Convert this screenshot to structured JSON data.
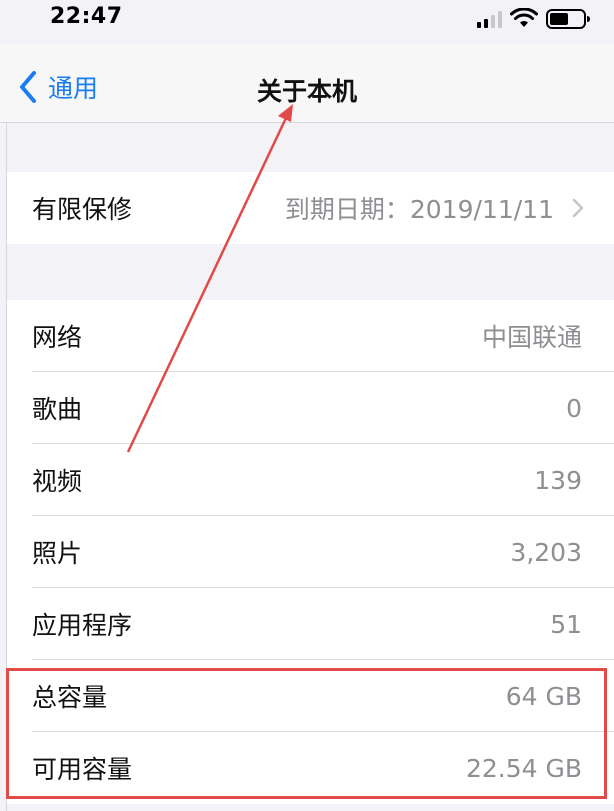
{
  "status_bar": {
    "time": "22:47"
  },
  "nav": {
    "back_label": "通用",
    "title": "关于本机"
  },
  "warranty": {
    "label": "有限保修",
    "value": "到期日期：2019/11/11"
  },
  "info_rows": [
    {
      "label": "网络",
      "value": "中国联通"
    },
    {
      "label": "歌曲",
      "value": "0"
    },
    {
      "label": "视频",
      "value": "139"
    },
    {
      "label": "照片",
      "value": "3,203"
    },
    {
      "label": "应用程序",
      "value": "51"
    },
    {
      "label": "总容量",
      "value": "64 GB"
    },
    {
      "label": "可用容量",
      "value": "22.54 GB"
    }
  ],
  "colors": {
    "accent": "#1a7cf5",
    "annotation": "#e24a4a",
    "background": "#f2f2f7"
  },
  "icons": [
    "signal-icon",
    "wifi-icon",
    "battery-icon",
    "back-chevron-icon",
    "chevron-right-icon"
  ]
}
